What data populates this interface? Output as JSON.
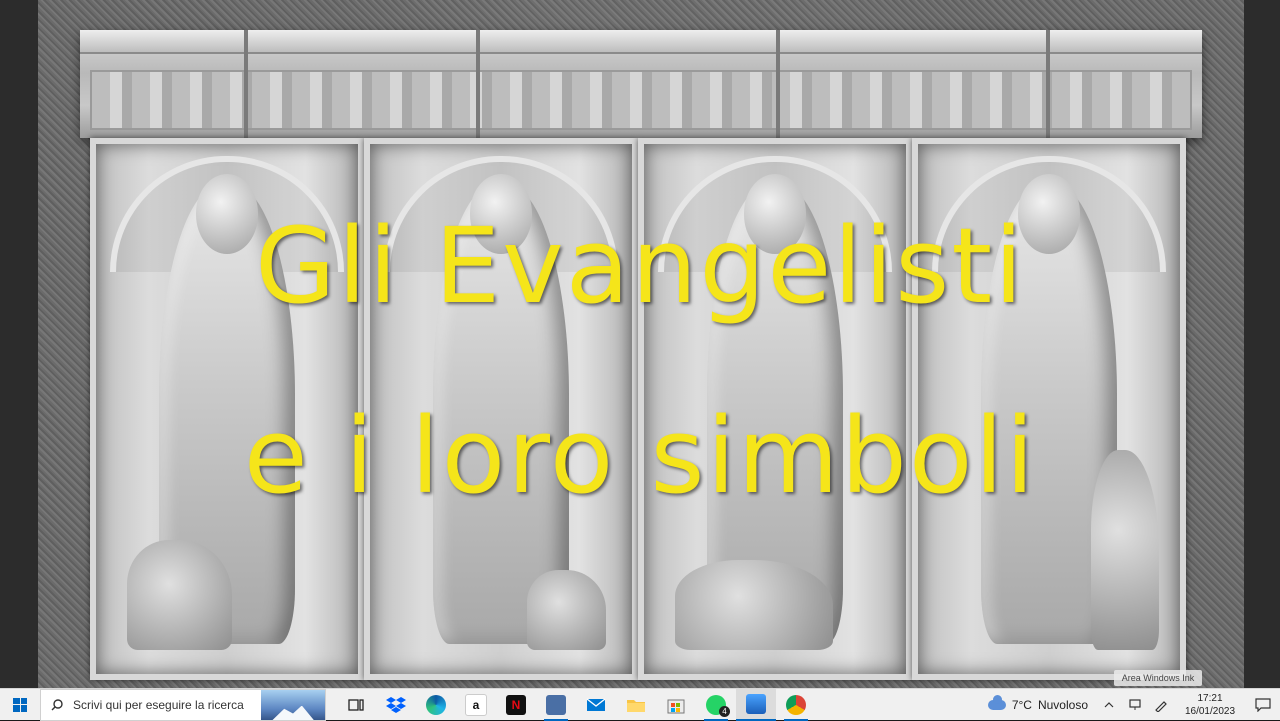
{
  "photo": {
    "title_line1": "Gli Evangelisti",
    "title_line2": "e i loro simboli",
    "watermark": "Area Windows Ink"
  },
  "taskbar": {
    "search_placeholder": "Scrivi qui per eseguire la ricerca",
    "apps": [
      {
        "name": "task-view",
        "label": ""
      },
      {
        "name": "dropbox",
        "label": ""
      },
      {
        "name": "edge",
        "label": ""
      },
      {
        "name": "amazon",
        "label": "a"
      },
      {
        "name": "netflix",
        "label": "N"
      },
      {
        "name": "app-window",
        "label": ""
      },
      {
        "name": "mail",
        "label": ""
      },
      {
        "name": "file-explorer",
        "label": ""
      },
      {
        "name": "store",
        "label": ""
      },
      {
        "name": "whatsapp",
        "label": ""
      },
      {
        "name": "photos",
        "label": ""
      },
      {
        "name": "chrome",
        "label": ""
      }
    ],
    "whatsapp_badge": "4",
    "weather": {
      "temp": "7°C",
      "condition": "Nuvoloso"
    },
    "clock": {
      "time": "17:21",
      "date": "16/01/2023"
    },
    "colors": {
      "accent": "#0067c0",
      "title_yellow": "#f5e51a"
    }
  }
}
